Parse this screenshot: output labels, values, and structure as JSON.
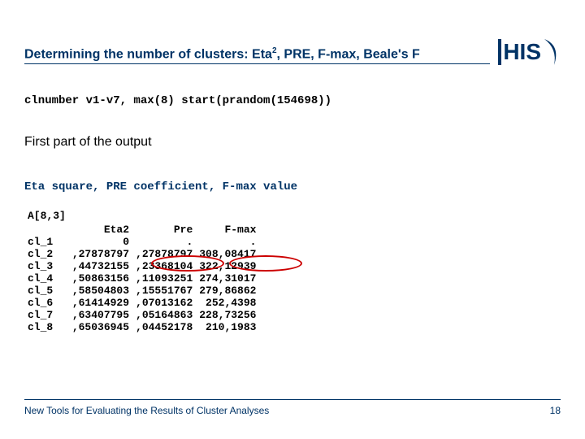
{
  "header": {
    "title_pre": "Determining the number of clusters: Eta",
    "title_sup": "2",
    "title_post": ", PRE, F-max, Beale's F",
    "logo_text": "HIS"
  },
  "command": "clnumber v1-v7, max(8) start(prandom(154698))",
  "subhead": "First part of the output",
  "section_label": "Eta square, PRE coefficient, F-max value",
  "table": {
    "dim": "A[8,3]",
    "cols": [
      "Eta2",
      "Pre",
      "F-max"
    ],
    "rows": [
      {
        "label": "cl_1",
        "eta2": "0",
        "pre": ".",
        "fmax": "."
      },
      {
        "label": "cl_2",
        "eta2": ",27878797",
        "pre": ",27878797",
        "fmax": "308,08417"
      },
      {
        "label": "cl_3",
        "eta2": ",44732155",
        "pre": ",23368104",
        "fmax": "322,12939"
      },
      {
        "label": "cl_4",
        "eta2": ",50863156",
        "pre": ",11093251",
        "fmax": "274,31017"
      },
      {
        "label": "cl_5",
        "eta2": ",58504803",
        "pre": ",15551767",
        "fmax": "279,86862"
      },
      {
        "label": "cl_6",
        "eta2": ",61414929",
        "pre": ",07013162",
        "fmax": "252,4398"
      },
      {
        "label": "cl_7",
        "eta2": ",63407795",
        "pre": ",05164863",
        "fmax": "228,73256"
      },
      {
        "label": "cl_8",
        "eta2": ",65036945",
        "pre": ",04452178",
        "fmax": "210,1983"
      }
    ]
  },
  "footer": {
    "text": "New Tools for Evaluating the Results of Cluster Analyses",
    "page": "18"
  }
}
